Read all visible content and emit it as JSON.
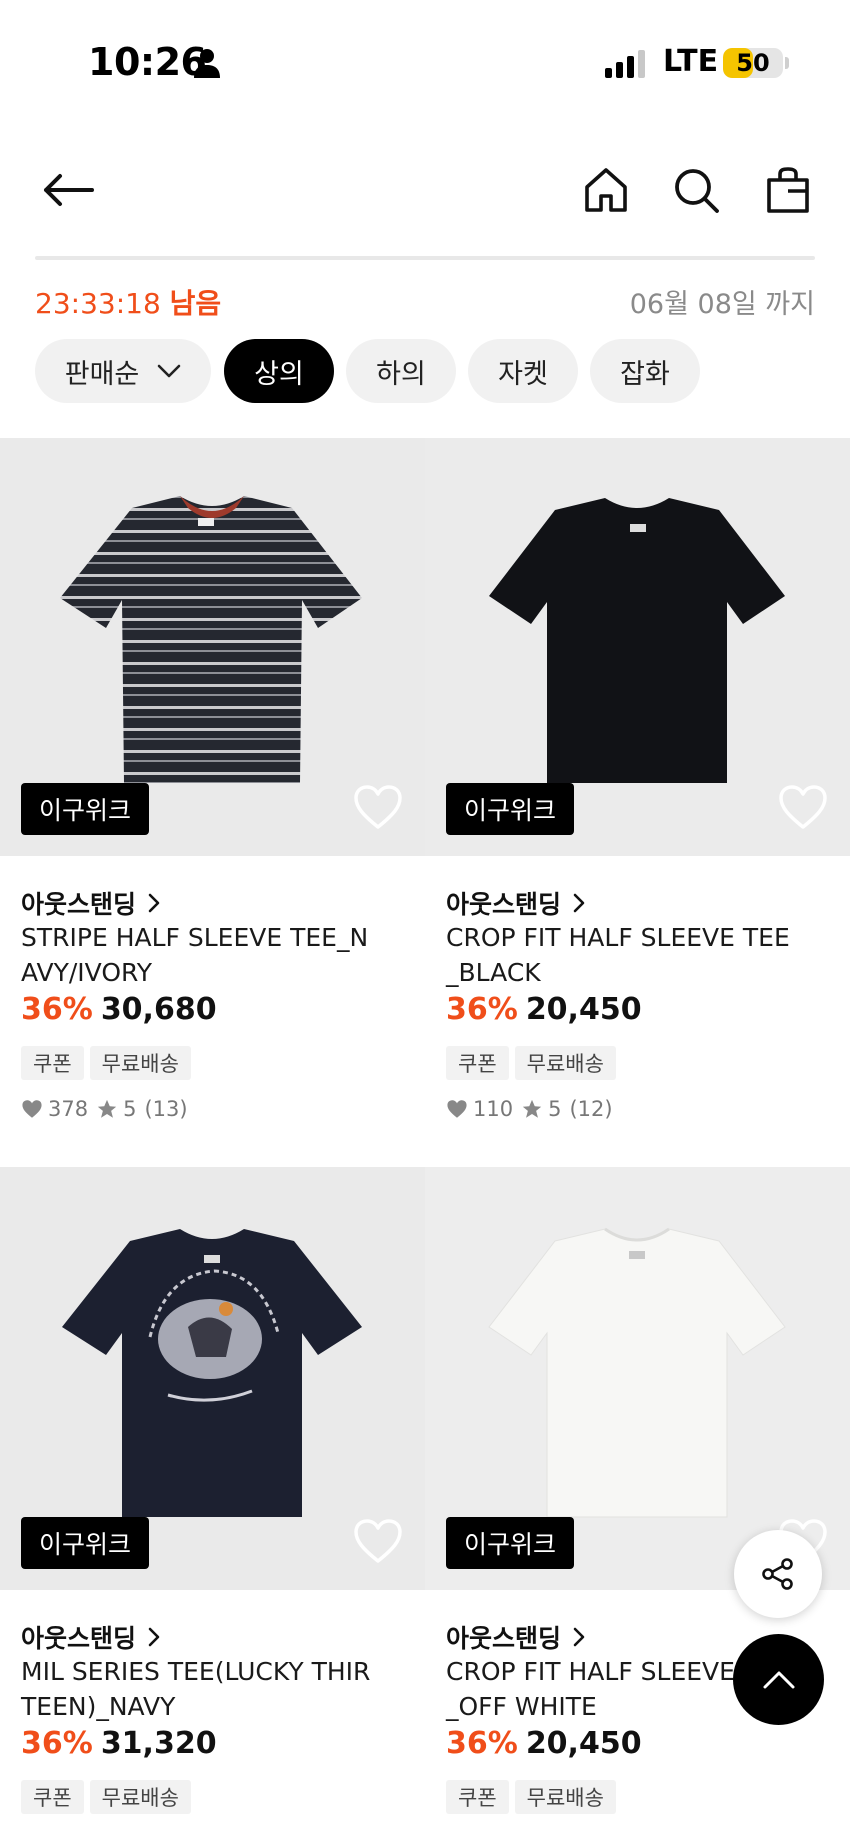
{
  "status_bar": {
    "time": "10:26",
    "network": "LTE",
    "battery_level": 50,
    "battery_text": "50",
    "battery_color": "#f5c400"
  },
  "header": {
    "back_icon": "arrow-left-icon",
    "home_icon": "home-icon",
    "search_icon": "search-icon",
    "bag_icon": "shopping-bag-icon"
  },
  "timer": {
    "countdown": "23:33:18",
    "remaining_label": "남음",
    "deadline": "06월 08일 까지",
    "accent_color": "#f04e1a"
  },
  "filters": {
    "sort_label": "판매순",
    "categories": [
      "상의",
      "하의",
      "자켓",
      "잡화"
    ],
    "active": "상의"
  },
  "products": [
    {
      "tag": "이구위크",
      "brand": "아웃스탠딩",
      "name": "STRIPE HALF SLEEVE TEE_NAVY/IVORY",
      "name_line1": "STRIPE HALF SLEEVE TEE_N",
      "name_line2": "AVY/IVORY",
      "discount": "36%",
      "price": "30,680",
      "badges": [
        "쿠폰",
        "무료배송"
      ],
      "likes": "378",
      "rating": "5",
      "reviews": "(13)"
    },
    {
      "tag": "이구위크",
      "brand": "아웃스탠딩",
      "name": "CROP FIT HALF SLEEVE TEE_BLACK",
      "name_line1": "CROP FIT HALF SLEEVE TEE",
      "name_line2": "_BLACK",
      "discount": "36%",
      "price": "20,450",
      "badges": [
        "쿠폰",
        "무료배송"
      ],
      "likes": "110",
      "rating": "5",
      "reviews": "(12)"
    },
    {
      "tag": "이구위크",
      "brand": "아웃스탠딩",
      "name": "MIL SERIES TEE(LUCKY THIRTEEN)_NAVY",
      "name_line1": "MIL SERIES TEE(LUCKY THIR",
      "name_line2": "TEEN)_NAVY",
      "discount": "36%",
      "price": "31,320",
      "badges": [
        "쿠폰",
        "무료배송"
      ],
      "likes": "",
      "rating": "",
      "reviews": ""
    },
    {
      "tag": "이구위크",
      "brand": "아웃스탠딩",
      "name": "CROP FIT HALF SLEEVE TEE_OFF WHITE",
      "name_line1": "CROP FIT HALF SLEEVE T",
      "name_line2": "_OFF WHITE",
      "discount": "36%",
      "price": "20,450",
      "badges": [
        "쿠폰",
        "무료배송"
      ],
      "likes": "",
      "rating": "",
      "reviews": ""
    }
  ],
  "floating": {
    "share_icon": "share-icon",
    "scroll_top_icon": "chevron-up-icon"
  }
}
